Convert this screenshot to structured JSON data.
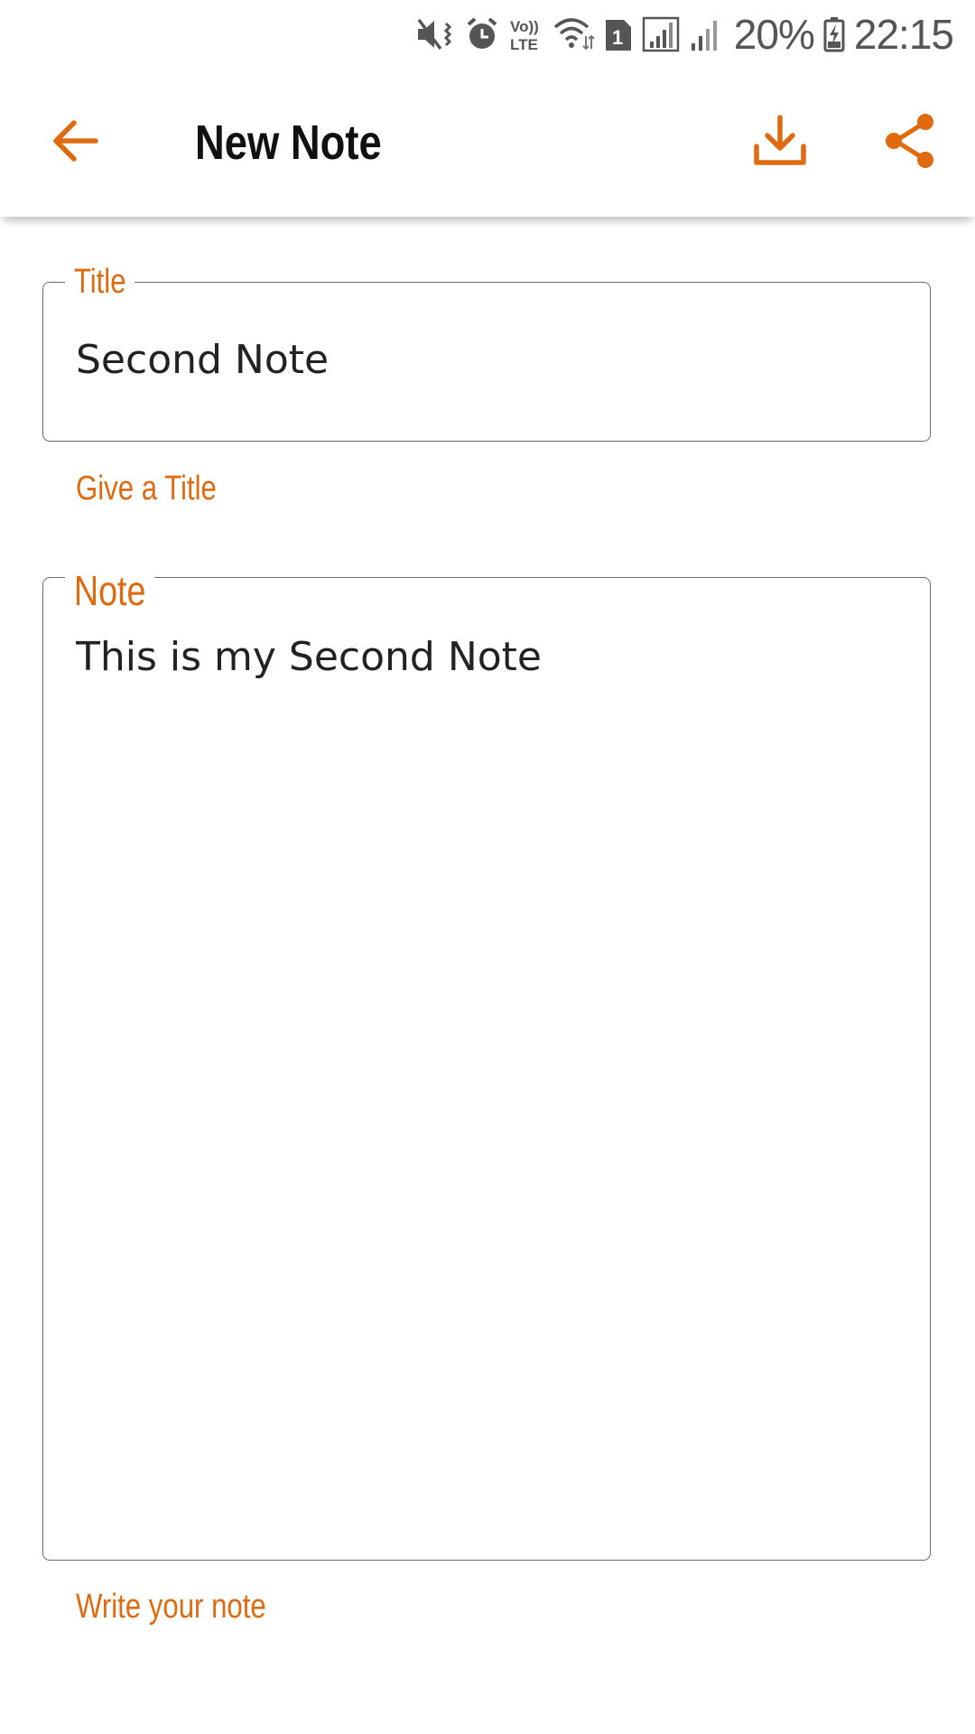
{
  "status_bar": {
    "battery": "20%",
    "time": "22:15",
    "sim_slot": "1",
    "icons": [
      "mute-icon",
      "alarm-icon",
      "volte-icon",
      "wifi-icon",
      "sim-icon",
      "signal-icon",
      "signal-icon",
      "battery-charging-icon"
    ]
  },
  "app_bar": {
    "title": "New Note",
    "back_icon": "arrow-back-icon",
    "save_icon": "download-icon",
    "share_icon": "share-icon"
  },
  "form": {
    "title_field": {
      "label": "Title",
      "value": "Second Note",
      "helper": "Give a Title"
    },
    "note_field": {
      "label": "Note",
      "value": "This is my Second Note",
      "helper": "Write your note"
    }
  },
  "colors": {
    "accent": "#e06a0f",
    "text": "#222222",
    "border": "#6b6b6b"
  }
}
